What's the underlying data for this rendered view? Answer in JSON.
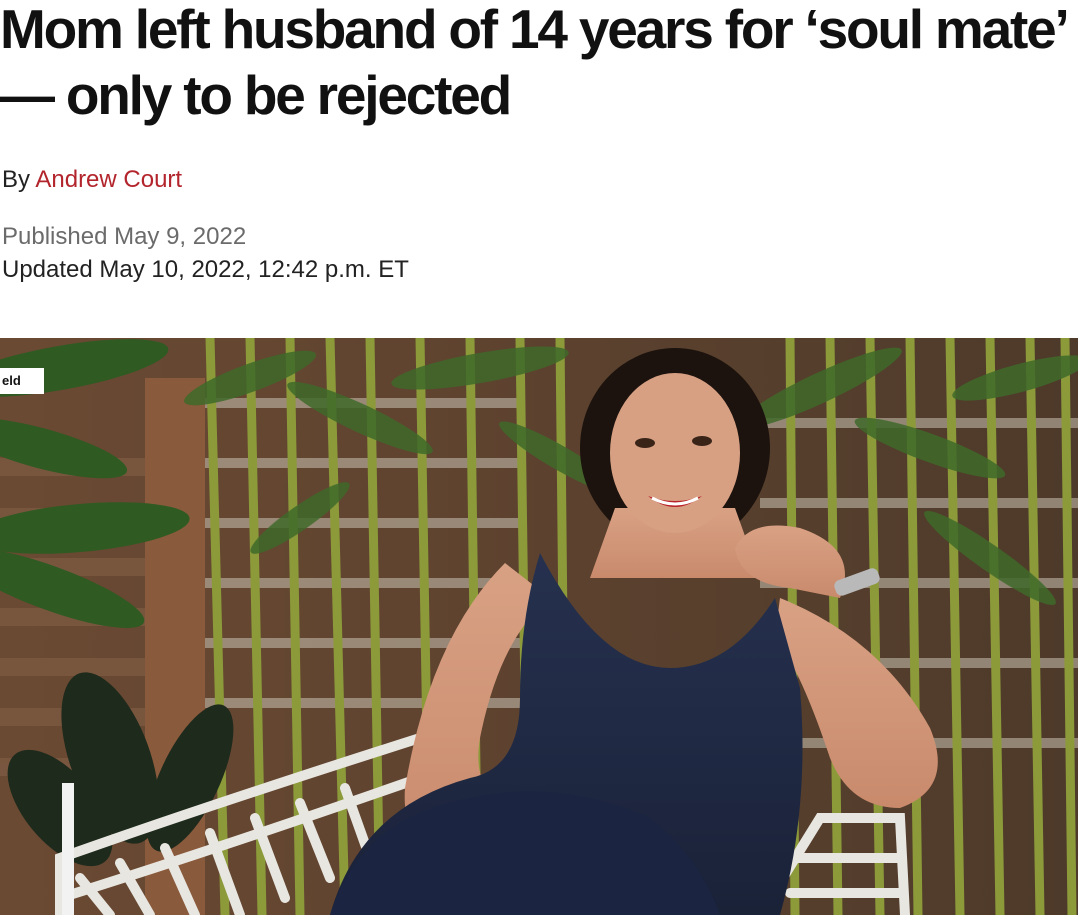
{
  "article": {
    "headline": "Mom left husband of 14 years for ‘soul mate’ — only to be rejected",
    "byline_prefix": "By",
    "author": "Andrew Court",
    "published": "Published May 9, 2022",
    "updated": "Updated May 10, 2022, 12:42 p.m. ET"
  },
  "photo": {
    "credit_fragment": "eld"
  },
  "colors": {
    "author_link": "#b3252c",
    "published_text": "#6b6b6b",
    "dress": "#1f2a44",
    "bamboo": "#8a9a3a"
  }
}
